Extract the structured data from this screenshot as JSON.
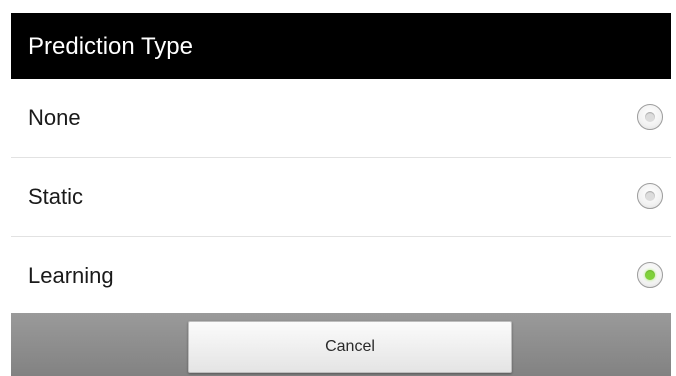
{
  "dialog": {
    "title": "Prediction Type",
    "options": [
      {
        "label": "None",
        "selected": false
      },
      {
        "label": "Static",
        "selected": false
      },
      {
        "label": "Learning",
        "selected": true
      }
    ],
    "cancel_label": "Cancel"
  },
  "colors": {
    "title_bar": "#000000",
    "title_text": "#ffffff",
    "selected_radio": "#7fd13a",
    "button_bar": "#8e8e8e"
  }
}
